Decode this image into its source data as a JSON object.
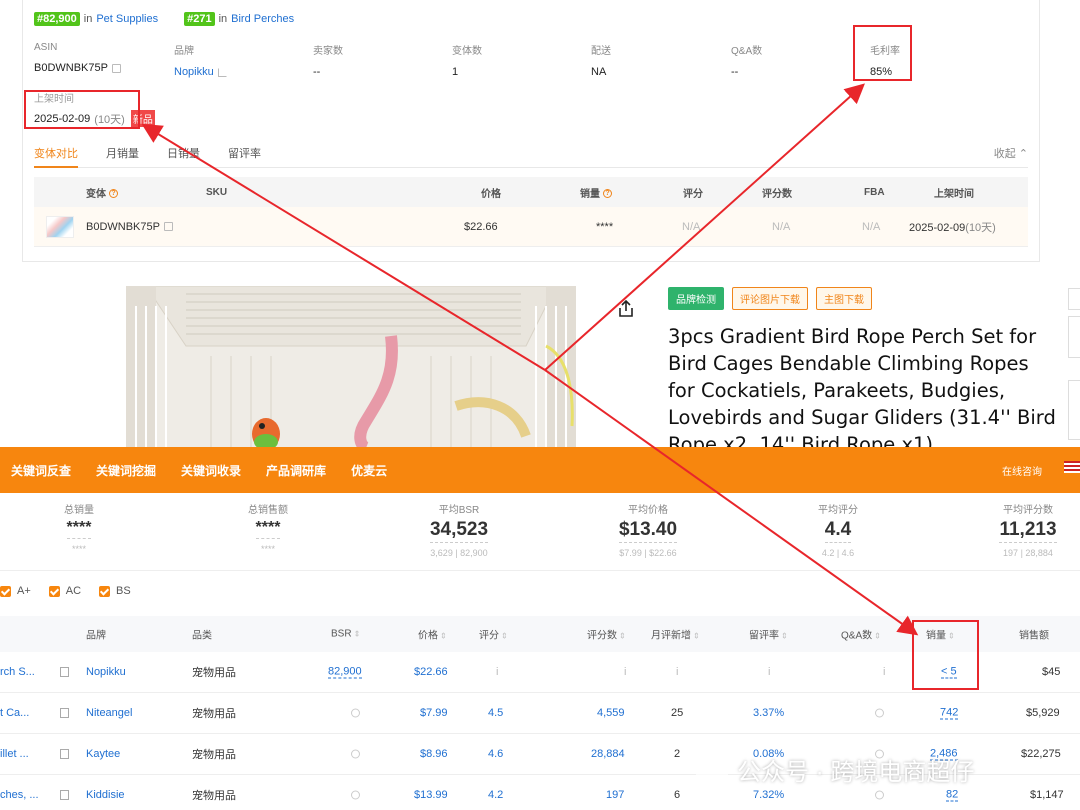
{
  "ranks": [
    {
      "badge": "#82,900",
      "in": "in",
      "category": "Pet Supplies"
    },
    {
      "badge": "#271",
      "in": "in",
      "category": "Bird Perches"
    }
  ],
  "meta": [
    {
      "label": "ASIN",
      "value": "B0DWNBK75P"
    },
    {
      "label": "品牌",
      "value": "Nopikku"
    },
    {
      "label": "卖家数",
      "value": "--"
    },
    {
      "label": "变体数",
      "value": "1"
    },
    {
      "label": "配送",
      "value": "NA"
    },
    {
      "label": "Q&A数",
      "value": "--"
    },
    {
      "label": "毛利率",
      "value": "85%"
    }
  ],
  "listed": {
    "label": "上架时间",
    "date": "2025-02-09",
    "days": "(10天)",
    "tag": "新品"
  },
  "tabs": [
    "变体对比",
    "月销量",
    "日销量",
    "留评率"
  ],
  "collapse": "收起 ⌃",
  "variant_table": {
    "headers": [
      "变体",
      "SKU",
      "价格",
      "销量",
      "评分",
      "评分数",
      "FBA",
      "上架时间"
    ],
    "row": {
      "asin": "B0DWNBK75P",
      "sku": "",
      "price": "$22.66",
      "sales": "****",
      "rating": "N/A",
      "rating_count": "N/A",
      "fba": "N/A",
      "listed": "2025-02-09",
      "days": "(10天)"
    }
  },
  "buttons": {
    "brand_check": "品牌检测",
    "review_img": "评论图片下载",
    "main_img": "主图下载"
  },
  "product_title": "3pcs Gradient Bird Rope Perch Set for Bird Cages Bendable Climbing Ropes for Cockatiels, Parakeets, Budgies, Lovebirds and Sugar Gliders (31.4'' Bird Rope x2, 14'' Bird Rope x1)",
  "toolbar": {
    "items": [
      "关键词反查",
      "关键词挖掘",
      "关键词收录",
      "产品调研库",
      "优麦云"
    ],
    "consult": "在线咨询"
  },
  "stats": [
    {
      "label": "总销量",
      "value": "****",
      "sub": "****"
    },
    {
      "label": "总销售额",
      "value": "****",
      "sub": "****"
    },
    {
      "label": "平均BSR",
      "value": "34,523",
      "sub": "3,629 | 82,900"
    },
    {
      "label": "平均价格",
      "value": "$13.40",
      "sub": "$7.99 | $22.66"
    },
    {
      "label": "平均评分",
      "value": "4.4",
      "sub": "4.2 | 4.6"
    },
    {
      "label": "平均评分数",
      "value": "11,213",
      "sub": "197 | 28,884"
    }
  ],
  "filters": [
    "A+",
    "AC",
    "BS"
  ],
  "main_table": {
    "headers": [
      "品牌",
      "品类",
      "BSR",
      "价格",
      "评分",
      "评分数",
      "月评新增",
      "留评率",
      "Q&A数",
      "销量",
      "销售额"
    ],
    "rows": [
      {
        "title": "rch S...",
        "brand": "Nopikku",
        "category": "宠物用品",
        "bsr": "82,900",
        "price": "$22.66",
        "rating": "i",
        "rating_count": "i",
        "new_reviews": "i",
        "review_rate": "i",
        "qa": "i",
        "sales": "< 5",
        "revenue": "$45"
      },
      {
        "title": "t Ca...",
        "brand": "Niteangel",
        "category": "宠物用品",
        "bsr": "",
        "price": "$7.99",
        "rating": "4.5",
        "rating_count": "4,559",
        "new_reviews": "25",
        "review_rate": "3.37%",
        "qa": "",
        "sales": "742",
        "revenue": "$5,929"
      },
      {
        "title": "illet ...",
        "brand": "Kaytee",
        "category": "宠物用品",
        "bsr": "",
        "price": "$8.96",
        "rating": "4.6",
        "rating_count": "28,884",
        "new_reviews": "2",
        "review_rate": "0.08%",
        "qa": "",
        "sales": "2,486",
        "revenue": "$22,275"
      },
      {
        "title": "ches, ...",
        "brand": "Kiddisie",
        "category": "宠物用品",
        "bsr": "",
        "price": "$13.99",
        "rating": "4.2",
        "rating_count": "197",
        "new_reviews": "6",
        "review_rate": "7.32%",
        "qa": "",
        "sales": "82",
        "revenue": "$1,147"
      }
    ]
  },
  "watermark": "公众号 · 跨境电商超仔",
  "colors": {
    "accent": "#f7860e",
    "link": "#1f6fd1",
    "highlight": "#e8262b",
    "badge_green": "#52c41a"
  }
}
